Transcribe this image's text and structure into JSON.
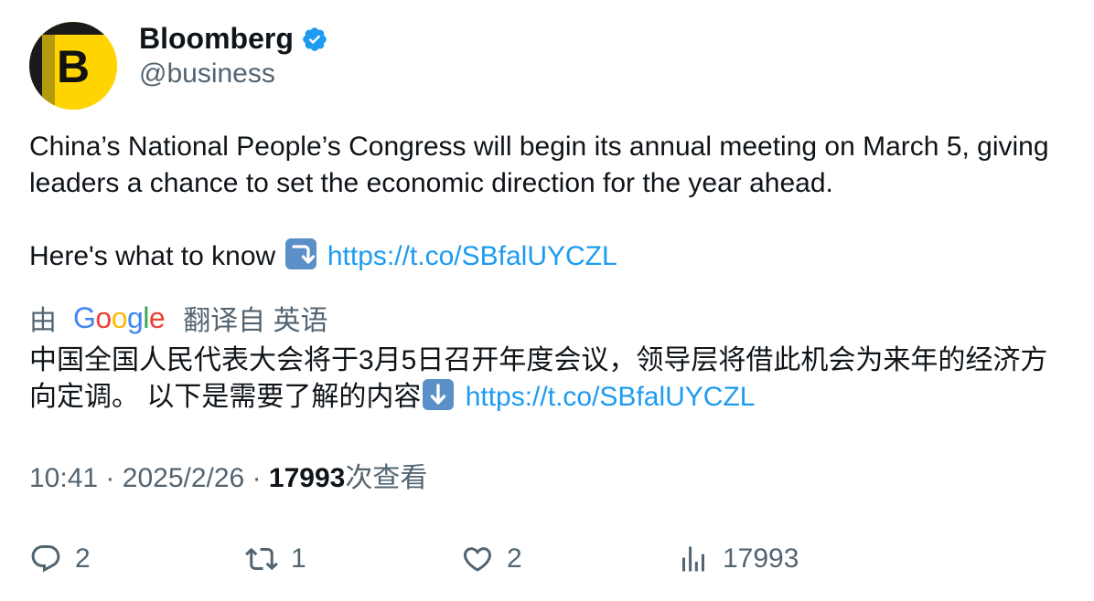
{
  "author": {
    "display_name": "Bloomberg",
    "handle": "@business",
    "avatar_letter": "B",
    "verified_icon": "verified-badge-icon",
    "colors": {
      "avatar_yellow": "#ffd400",
      "verified_blue": "#1d9bf0"
    }
  },
  "tweet": {
    "line1": "China’s National People’s Congress will begin its annual meeting on March 5, giving leaders a chance to set the economic direction for the year ahead.",
    "line2_prefix": "Here's what to know",
    "emoji_icon": "right-arrow-curving-down-icon",
    "link": "https://t.co/SBfalUYCZL"
  },
  "translation": {
    "by_label": "由",
    "google_letters": [
      "G",
      "o",
      "o",
      "g",
      "l",
      "e"
    ],
    "translated_from_label": "翻译自 英语",
    "text": "中国全国人民代表大会将于3月5日召开年度会议，领导层将借此机会为来年的经济方向定调。 以下是需要了解的内容",
    "emoji_icon": "down-arrow-icon",
    "link": "https://t.co/SBfalUYCZL"
  },
  "meta": {
    "time": "10:41",
    "separator": "·",
    "date": "2025/2/26",
    "views_count": "17993",
    "views_label": "次查看"
  },
  "actions": {
    "reply_count": "2",
    "retweet_count": "1",
    "like_count": "2",
    "views_count": "17993"
  },
  "colors": {
    "text_primary": "#0f1419",
    "text_secondary": "#536471",
    "link": "#1d9bf0"
  }
}
